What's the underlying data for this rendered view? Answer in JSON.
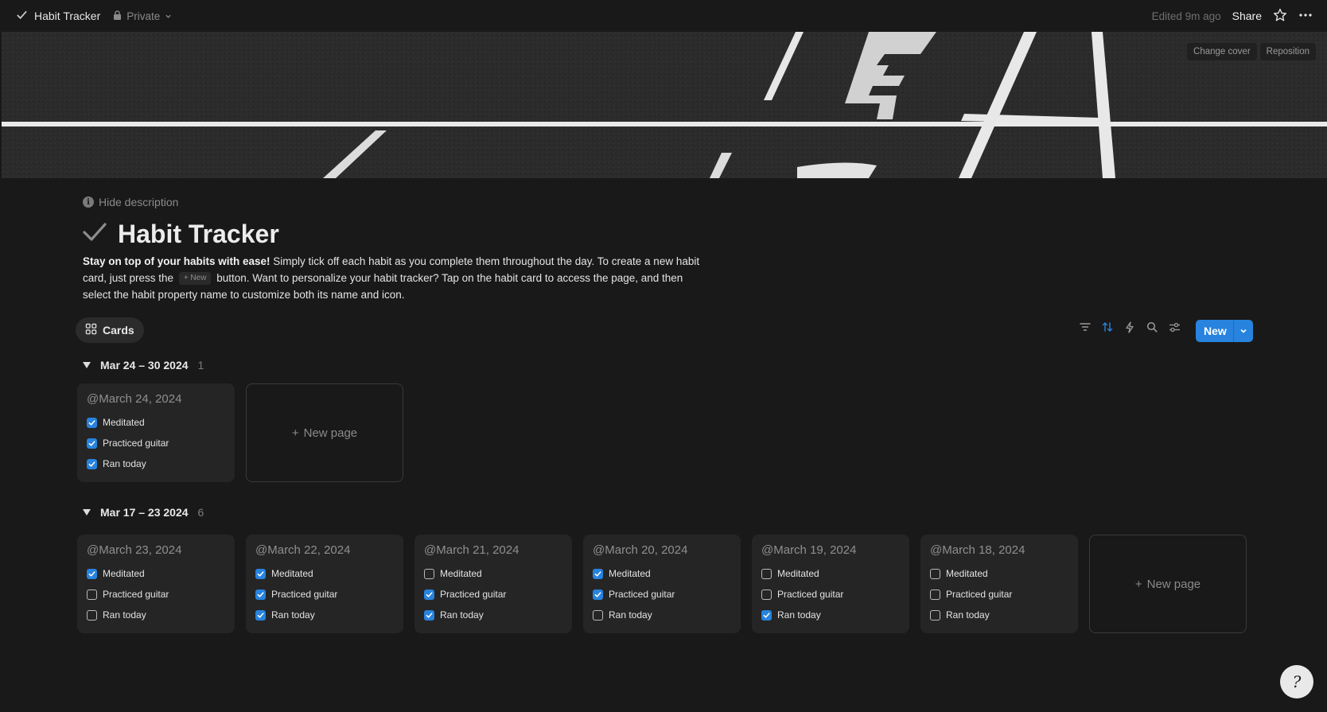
{
  "topbar": {
    "page_name": "Habit Tracker",
    "privacy": "Private",
    "edited": "Edited 9m ago",
    "share": "Share"
  },
  "cover": {
    "change_cover": "Change cover",
    "reposition": "Reposition"
  },
  "hide_description": "Hide description",
  "title": "Habit Tracker",
  "description": {
    "bold_lead": "Stay on top of your habits with ease!",
    "part1": " Simply tick off each habit as you complete them throughout the day. To create a new habit card, just press the ",
    "inline_button": "+ New",
    "part2": " button. Want to personalize your habit tracker? Tap on the habit card to access the page, and then select the habit property name to customize both its name and icon."
  },
  "view": {
    "tab_label": "Cards",
    "new_label": "New"
  },
  "accent_color": "#2783de",
  "new_page_label": "New page",
  "groups": [
    {
      "label": "Mar 24 – 30 2024",
      "count": "1",
      "cards": [
        {
          "date": "@March 24, 2024",
          "habits": [
            {
              "label": "Meditated",
              "checked": true
            },
            {
              "label": "Practiced guitar",
              "checked": true
            },
            {
              "label": "Ran today",
              "checked": true
            }
          ]
        }
      ]
    },
    {
      "label": "Mar 17 – 23 2024",
      "count": "6",
      "cards": [
        {
          "date": "@March 23, 2024",
          "habits": [
            {
              "label": "Meditated",
              "checked": true
            },
            {
              "label": "Practiced guitar",
              "checked": false
            },
            {
              "label": "Ran today",
              "checked": false
            }
          ]
        },
        {
          "date": "@March 22, 2024",
          "habits": [
            {
              "label": "Meditated",
              "checked": true
            },
            {
              "label": "Practiced guitar",
              "checked": true
            },
            {
              "label": "Ran today",
              "checked": true
            }
          ]
        },
        {
          "date": "@March 21, 2024",
          "habits": [
            {
              "label": "Meditated",
              "checked": false
            },
            {
              "label": "Practiced guitar",
              "checked": true
            },
            {
              "label": "Ran today",
              "checked": true
            }
          ]
        },
        {
          "date": "@March 20, 2024",
          "habits": [
            {
              "label": "Meditated",
              "checked": true
            },
            {
              "label": "Practiced guitar",
              "checked": true
            },
            {
              "label": "Ran today",
              "checked": false
            }
          ]
        },
        {
          "date": "@March 19, 2024",
          "habits": [
            {
              "label": "Meditated",
              "checked": false
            },
            {
              "label": "Practiced guitar",
              "checked": false
            },
            {
              "label": "Ran today",
              "checked": true
            }
          ]
        },
        {
          "date": "@March 18, 2024",
          "habits": [
            {
              "label": "Meditated",
              "checked": false
            },
            {
              "label": "Practiced guitar",
              "checked": false
            },
            {
              "label": "Ran today",
              "checked": false
            }
          ]
        }
      ]
    }
  ]
}
